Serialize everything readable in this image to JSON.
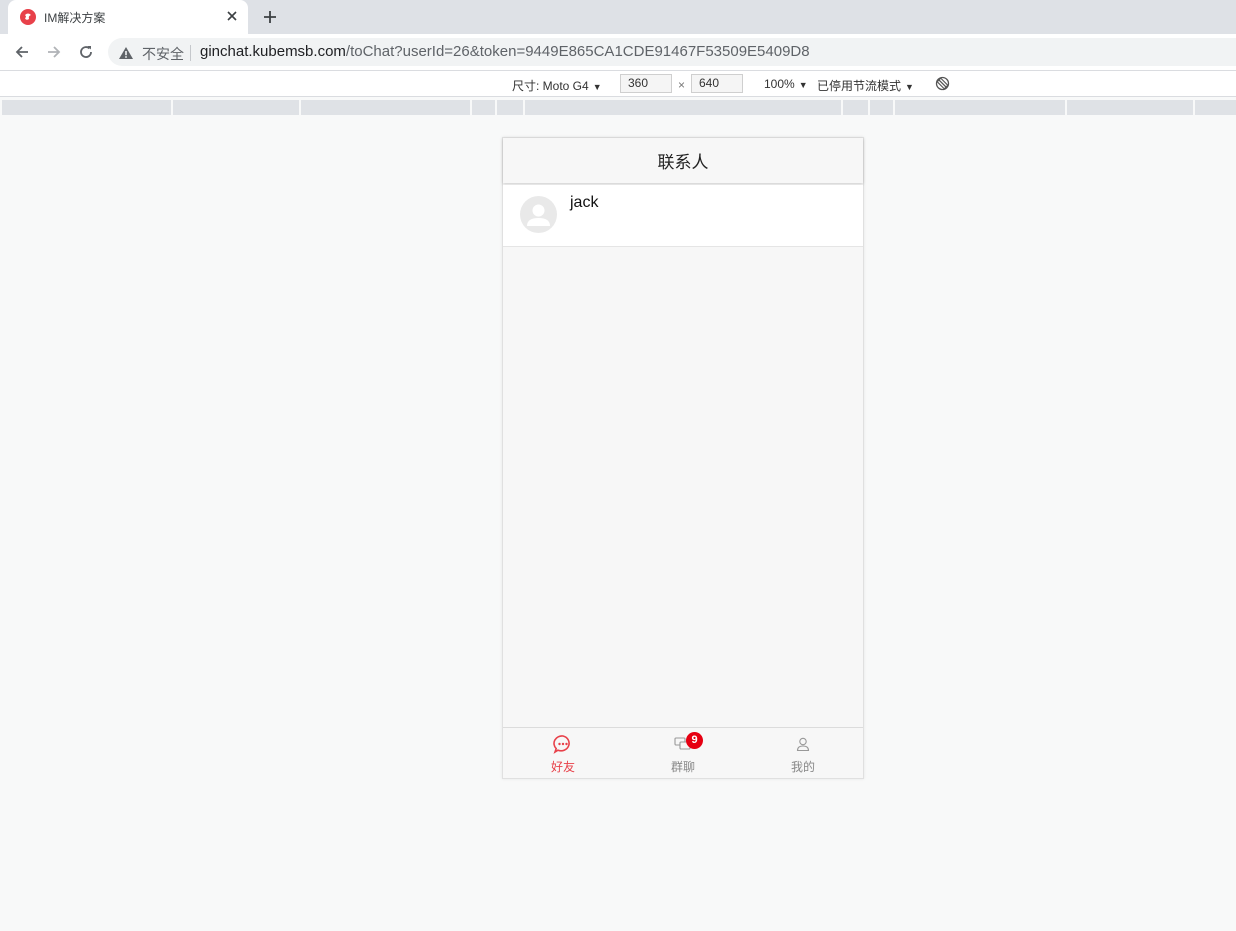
{
  "browser": {
    "tab": {
      "title": "IM解决方案",
      "favicon": "app-logo-icon"
    },
    "address": {
      "security_label": "不安全",
      "host": "ginchat.kubemsb.com",
      "path": "/toChat?userId=26&token=9449E865CA1CDE91467F53509E5409D8"
    }
  },
  "device_toolbar": {
    "device_label": "尺寸: Moto G4",
    "width": "360",
    "times": "×",
    "height": "640",
    "zoom": "100%",
    "throttle": "已停用节流模式"
  },
  "app": {
    "header_title": "联系人",
    "contacts": [
      {
        "name": "jack"
      }
    ],
    "tabbar": [
      {
        "label": "好友",
        "icon": "chat-bubble-icon",
        "active": true
      },
      {
        "label": "群聊",
        "icon": "group-chat-icon",
        "badge": "9"
      },
      {
        "label": "我的",
        "icon": "user-icon"
      }
    ],
    "colors": {
      "accent": "#e8414a",
      "badge": "#e60012"
    }
  }
}
